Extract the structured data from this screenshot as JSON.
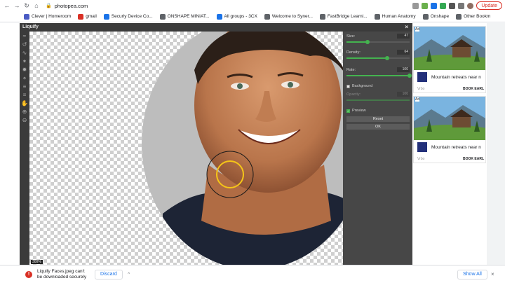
{
  "browser": {
    "url": "photopea.com",
    "update_label": "Update",
    "bookmarks": [
      {
        "label": "Clever | Homeroom",
        "color": "#4b5cc4"
      },
      {
        "label": "gmail",
        "color": "#d93025"
      },
      {
        "label": "Securly Device Co...",
        "color": "#1a73e8"
      },
      {
        "label": "ONSHAPE MINIAT...",
        "color": "#5f6368"
      },
      {
        "label": "All groups - 3CX",
        "color": "#1a73e8"
      },
      {
        "label": "Welcome to Syner...",
        "color": "#5f6368"
      },
      {
        "label": "FastBridge Learni...",
        "color": "#5f6368"
      },
      {
        "label": "Human Anatomy",
        "color": "#5f6368"
      },
      {
        "label": "Onshape",
        "color": "#5f6368"
      },
      {
        "label": "Other Bookm",
        "color": "#5f6368"
      }
    ]
  },
  "dialog": {
    "title": "Liquify",
    "close": "×",
    "zoom": "300%",
    "size_label": "Size:",
    "size_value": "47",
    "size_fraction": 0.33,
    "density_label": "Density:",
    "density_value": "64",
    "density_fraction": 0.64,
    "rate_label": "Rate:",
    "rate_value": "100",
    "rate_fraction": 1.0,
    "background_label": "Background",
    "opacity_label": "Opacity:",
    "opacity_value": "100",
    "preview_label": "Preview",
    "reset_label": "Reset",
    "ok_label": "OK"
  },
  "ads": [
    {
      "marker": "Ad",
      "title": "Mountain retreats near n",
      "source": "Vrbo",
      "cta": "BOOK EARL"
    },
    {
      "marker": "Ad",
      "title": "Mountain retreats near n",
      "source": "Vrbo",
      "cta": "BOOK EARL"
    }
  ],
  "download": {
    "text": "Liquify Faces.jpeg can't be downloaded securely",
    "discard_label": "Discard",
    "show_all_label": "Show All"
  },
  "colors": {
    "accent": "#44b34f",
    "panel": "#474747",
    "brush": "#f5c518"
  }
}
